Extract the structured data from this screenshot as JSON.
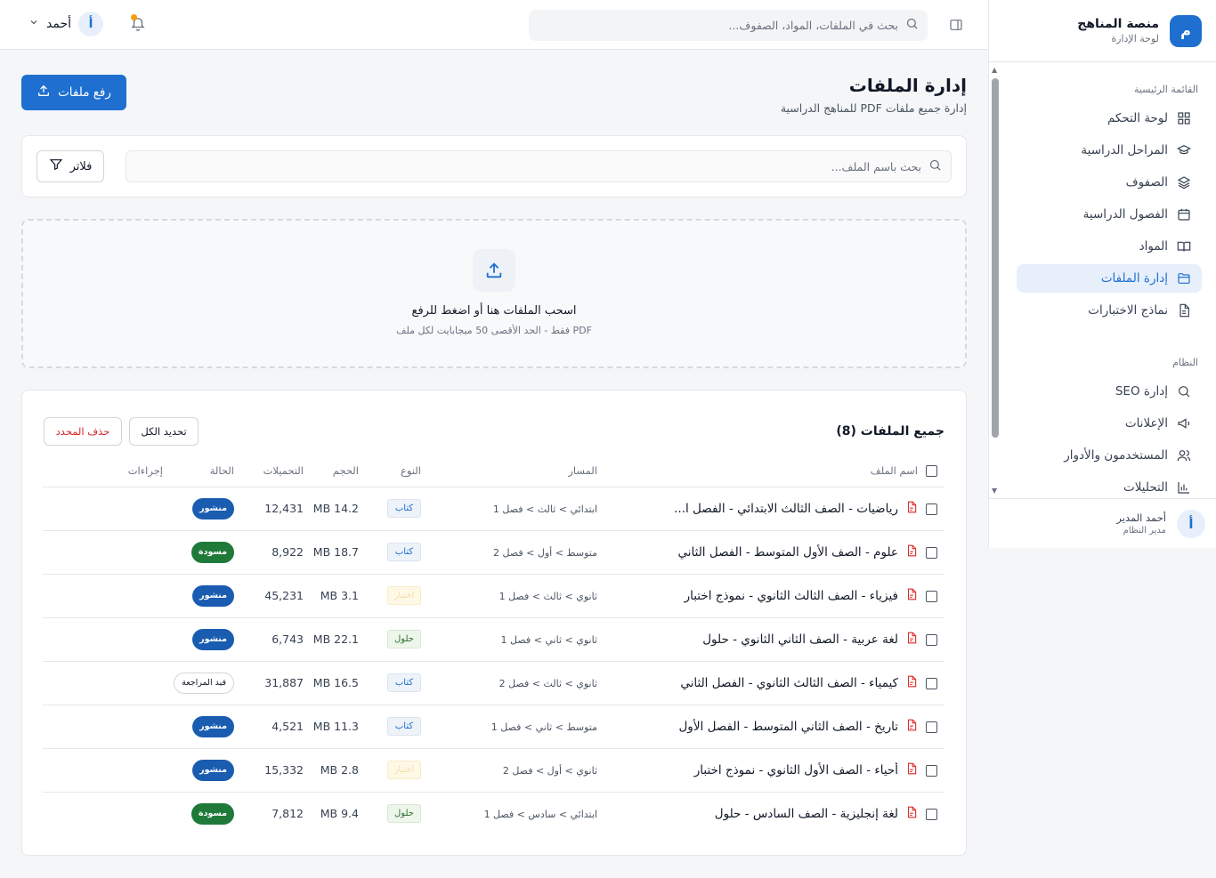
{
  "brand": {
    "logo": "م",
    "title": "منصة المناهج",
    "subtitle": "لوحة الإدارة"
  },
  "sidebar": {
    "sections": [
      {
        "title": "القائمة الرئيسية",
        "items": [
          {
            "label": "لوحة التحكم",
            "icon": "grid-icon"
          },
          {
            "label": "المراحل الدراسية",
            "icon": "graduation-cap-icon"
          },
          {
            "label": "الصفوف",
            "icon": "layers-icon"
          },
          {
            "label": "الفصول الدراسية",
            "icon": "calendar-icon"
          },
          {
            "label": "المواد",
            "icon": "book-icon"
          },
          {
            "label": "إدارة الملفات",
            "icon": "folder-icon",
            "active": true
          },
          {
            "label": "نماذج الاختبارات",
            "icon": "document-icon"
          }
        ]
      },
      {
        "title": "النظام",
        "items": [
          {
            "label": "إدارة SEO",
            "icon": "search-icon"
          },
          {
            "label": "الإعلانات",
            "icon": "megaphone-icon"
          },
          {
            "label": "المستخدمون والأدوار",
            "icon": "users-icon"
          },
          {
            "label": "التحليلات",
            "icon": "bar-chart-icon"
          }
        ]
      }
    ],
    "user": {
      "avatar": "أ",
      "name": "أحمد المدير",
      "role": "مدير النظام"
    }
  },
  "topbar": {
    "search_placeholder": "بحث في الملفات، المواد، الصفوف...",
    "user_name": "أحمد",
    "avatar": "أ"
  },
  "page": {
    "title": "إدارة الملفات",
    "subtitle": "إدارة جميع ملفات PDF للمناهج الدراسية",
    "upload_label": "رفع ملفات"
  },
  "filters": {
    "search_placeholder": "بحث باسم الملف...",
    "filter_label": "فلاتر"
  },
  "dropzone": {
    "title": "اسحب الملفات هنا أو اضغط للرفع",
    "subtitle": "PDF فقط - الحد الأقصى 50 ميجابايت لكل ملف"
  },
  "table": {
    "title": "جميع الملفات (8)",
    "select_all_label": "تحديد الكل",
    "delete_selected_label": "حذف المحدد",
    "columns": [
      "اسم الملف",
      "المسار",
      "النوع",
      "الحجم",
      "التحميلات",
      "الحالة",
      "إجراءات"
    ],
    "rows": [
      {
        "name": "رياضيات - الصف الثالث الابتدائي - الفصل ا...",
        "path": "ابتدائي > ثالث > فصل 1",
        "type": "كتاب",
        "type_kind": "book",
        "size": "14.2 MB",
        "downloads": "12,431",
        "status": "منشور",
        "status_kind": "pub"
      },
      {
        "name": "علوم - الصف الأول المتوسط - الفصل الثاني",
        "path": "متوسط > أول > فصل 2",
        "type": "كتاب",
        "type_kind": "book",
        "size": "18.7 MB",
        "downloads": "8,922",
        "status": "مسودة",
        "status_kind": "draft"
      },
      {
        "name": "فيزياء - الصف الثالث الثانوي - نموذج اختبار",
        "path": "ثانوي > ثالث > فصل 1",
        "type": "اختبار",
        "type_kind": "exam",
        "size": "3.1 MB",
        "downloads": "45,231",
        "status": "منشور",
        "status_kind": "pub"
      },
      {
        "name": "لغة عربية - الصف الثاني الثانوي - حلول",
        "path": "ثانوي > ثاني > فصل 1",
        "type": "حلول",
        "type_kind": "sol",
        "size": "22.1 MB",
        "downloads": "6,743",
        "status": "منشور",
        "status_kind": "pub"
      },
      {
        "name": "كيمياء - الصف الثالث الثانوي - الفصل الثاني",
        "path": "ثانوي > ثالث > فصل 2",
        "type": "كتاب",
        "type_kind": "book",
        "size": "16.5 MB",
        "downloads": "31,887",
        "status": "قيد المراجعة",
        "status_kind": "review"
      },
      {
        "name": "تاريخ - الصف الثاني المتوسط - الفصل الأول",
        "path": "متوسط > ثاني > فصل 1",
        "type": "كتاب",
        "type_kind": "book",
        "size": "11.3 MB",
        "downloads": "4,521",
        "status": "منشور",
        "status_kind": "pub"
      },
      {
        "name": "أحياء - الصف الأول الثانوي - نموذج اختبار",
        "path": "ثانوي > أول > فصل 2",
        "type": "اختبار",
        "type_kind": "exam",
        "size": "2.8 MB",
        "downloads": "15,332",
        "status": "منشور",
        "status_kind": "pub"
      },
      {
        "name": "لغة إنجليزية - الصف السادس - حلول",
        "path": "ابتدائي > سادس > فصل 1",
        "type": "حلول",
        "type_kind": "sol",
        "size": "9.4 MB",
        "downloads": "7,812",
        "status": "مسودة",
        "status_kind": "draft"
      }
    ]
  }
}
